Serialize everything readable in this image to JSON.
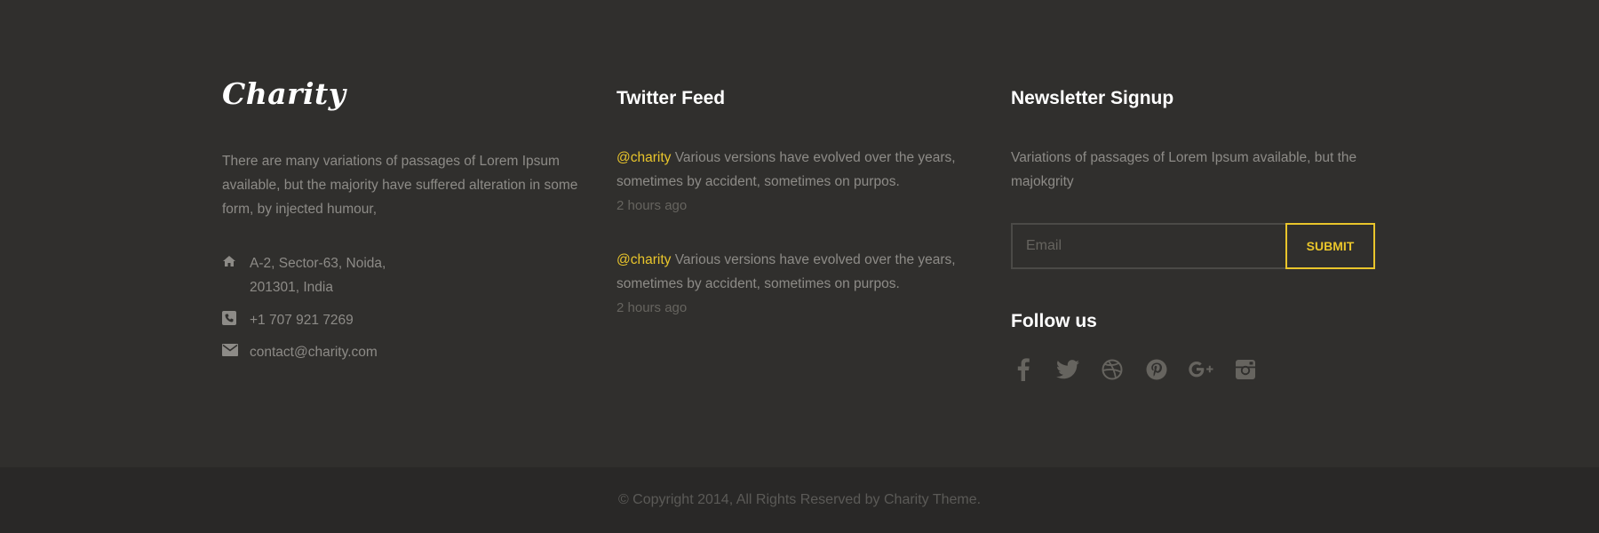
{
  "brand": {
    "name": "Charity"
  },
  "about": {
    "text": "There are many variations of passages of Lorem Ipsum available, but the majority have suffered alteration in some form, by injected humour,"
  },
  "contact": {
    "address_line1": "A-2, Sector-63, Noida,",
    "address_line2": "201301, India",
    "phone": "+1 707 921 7269",
    "email": "contact@charity.com",
    "icons": {
      "address": "home-icon",
      "phone": "phone-icon",
      "email": "envelope-icon"
    }
  },
  "twitter": {
    "title": "Twitter Feed",
    "tweets": [
      {
        "handle": "@charity",
        "text": " Various versions have evolved over the years, sometimes by accident, sometimes on purpos.",
        "time": "2 hours ago"
      },
      {
        "handle": "@charity",
        "text": " Various versions have evolved over the years, sometimes by accident, sometimes on purpos.",
        "time": "2 hours ago"
      }
    ]
  },
  "newsletter": {
    "title": "Newsletter Signup",
    "description": "Variations of passages of Lorem Ipsum available, but the majokgrity",
    "email_placeholder": "Email",
    "email_value": "",
    "submit_label": "SUBMIT"
  },
  "follow": {
    "title": "Follow us",
    "icons": [
      "facebook-icon",
      "twitter-icon",
      "dribbble-icon",
      "pinterest-icon",
      "google-plus-icon",
      "instagram-icon"
    ]
  },
  "copyright": "© Copyright 2014, All Rights Reserved by Charity Theme.",
  "colors": {
    "background": "#302f2d",
    "copyright_bar": "#292827",
    "accent": "#e9c52b",
    "heading": "#ffffff",
    "body_text": "#8d8b87",
    "muted": "#66645f"
  }
}
